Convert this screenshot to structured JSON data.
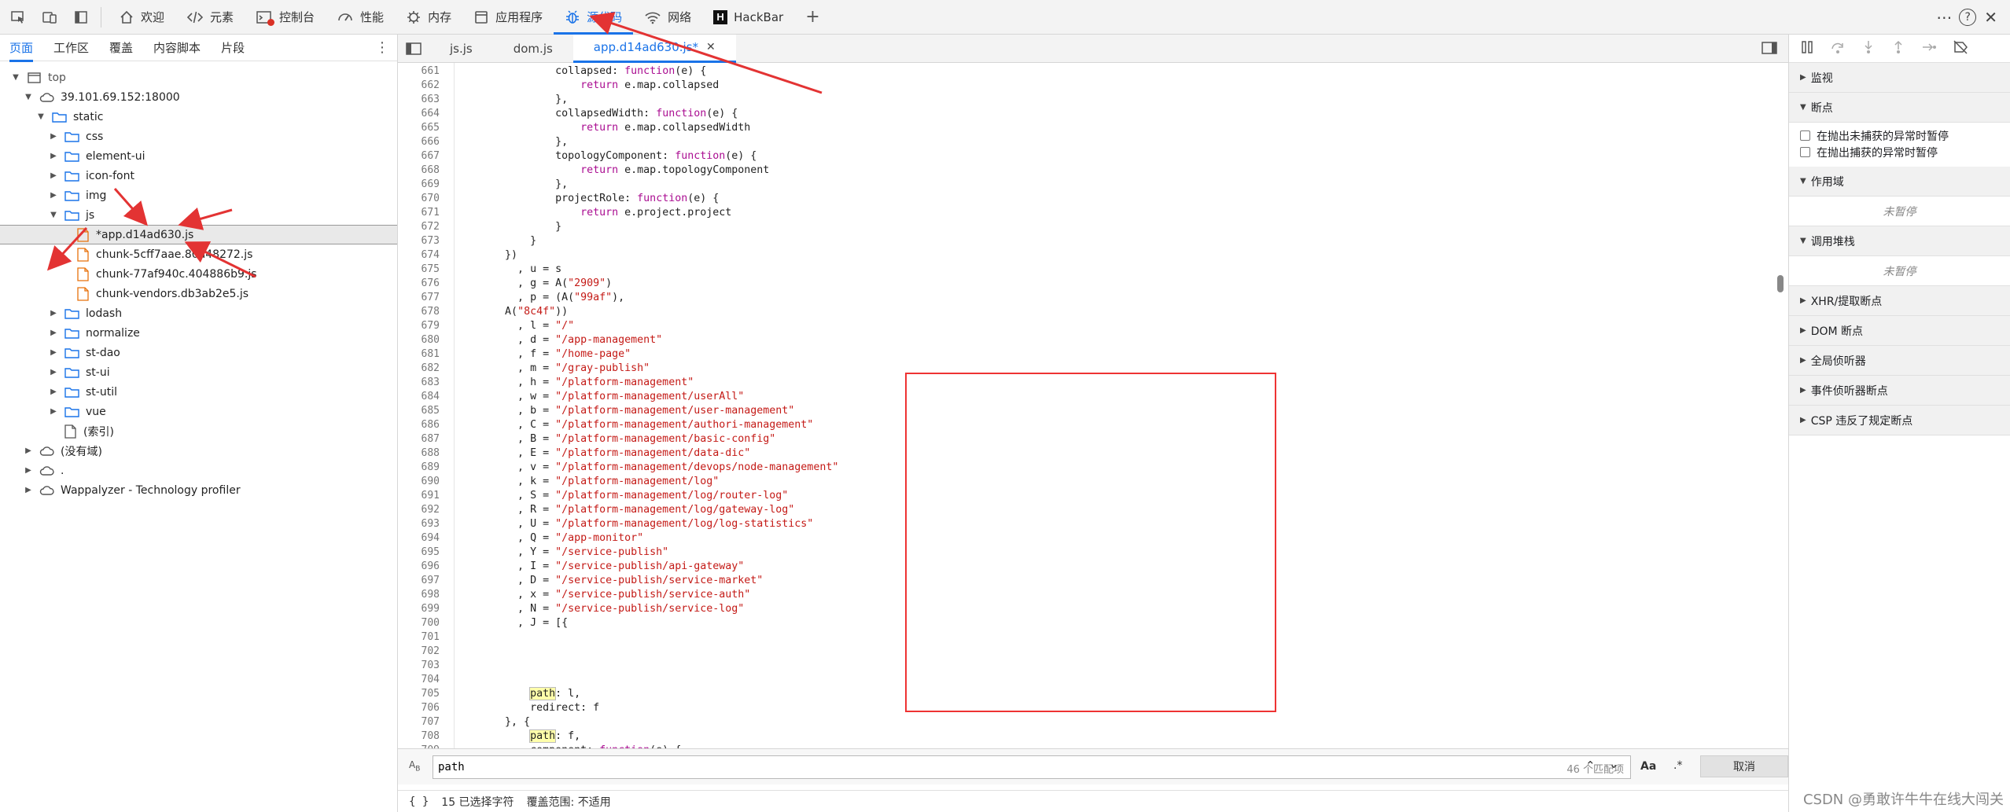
{
  "toolbar": {
    "tabs": [
      {
        "label": "欢迎",
        "icon": "home-icon"
      },
      {
        "label": "元素",
        "icon": "code-tags-icon"
      },
      {
        "label": "控制台",
        "icon": "console-icon"
      },
      {
        "label": "性能",
        "icon": "performance-icon"
      },
      {
        "label": "内存",
        "icon": "memory-icon"
      },
      {
        "label": "应用程序",
        "icon": "application-icon"
      },
      {
        "label": "源代码",
        "icon": "bug-icon",
        "active": true
      },
      {
        "label": "网络",
        "icon": "wifi-icon"
      },
      {
        "label": "HackBar",
        "icon": "hackbar-icon"
      }
    ],
    "add_tab": "+",
    "help": "?"
  },
  "navigator": {
    "tabs": [
      "页面",
      "工作区",
      "覆盖",
      "内容脚本",
      "片段"
    ],
    "tree": [
      {
        "label": "top",
        "type": "frame",
        "depth": 0,
        "expanded": true
      },
      {
        "label": "39.101.69.152:18000",
        "type": "cloud",
        "depth": 1,
        "expanded": true
      },
      {
        "label": "static",
        "type": "folder",
        "depth": 2,
        "expanded": true
      },
      {
        "label": "css",
        "type": "folder",
        "depth": 3,
        "expanded": false
      },
      {
        "label": "element-ui",
        "type": "folder",
        "depth": 3,
        "expanded": false
      },
      {
        "label": "icon-font",
        "type": "folder",
        "depth": 3,
        "expanded": false
      },
      {
        "label": "img",
        "type": "folder",
        "depth": 3,
        "expanded": false
      },
      {
        "label": "js",
        "type": "folder",
        "depth": 3,
        "expanded": true
      },
      {
        "label": "*app.d14ad630.js",
        "type": "file",
        "depth": 4,
        "selected": true
      },
      {
        "label": "chunk-5cff7aae.80a48272.js",
        "type": "file",
        "depth": 4
      },
      {
        "label": "chunk-77af940c.404886b9.js",
        "type": "file",
        "depth": 4
      },
      {
        "label": "chunk-vendors.db3ab2e5.js",
        "type": "file",
        "depth": 4
      },
      {
        "label": "lodash",
        "type": "folder",
        "depth": 3,
        "expanded": false
      },
      {
        "label": "normalize",
        "type": "folder",
        "depth": 3,
        "expanded": false
      },
      {
        "label": "st-dao",
        "type": "folder",
        "depth": 3,
        "expanded": false
      },
      {
        "label": "st-ui",
        "type": "folder",
        "depth": 3,
        "expanded": false
      },
      {
        "label": "st-util",
        "type": "folder",
        "depth": 3,
        "expanded": false
      },
      {
        "label": "vue",
        "type": "folder",
        "depth": 3,
        "expanded": false
      },
      {
        "label": "(索引)",
        "type": "doc",
        "depth": 3
      },
      {
        "label": "(没有域)",
        "type": "cloud",
        "depth": 1,
        "expanded": false
      },
      {
        "label": ".",
        "type": "cloud",
        "depth": 1,
        "expanded": false
      },
      {
        "label": "Wappalyzer - Technology profiler",
        "type": "cloud",
        "depth": 1,
        "expanded": false
      }
    ]
  },
  "editor": {
    "tabs": [
      {
        "label": "js.js"
      },
      {
        "label": "dom.js"
      },
      {
        "label": "app.d14ad630.js*",
        "active": true,
        "closable": true
      }
    ],
    "lines": [
      {
        "n": "661",
        "text": "                collapsed: function(e) {"
      },
      {
        "n": "662",
        "text": "                    return e.map.collapsed"
      },
      {
        "n": "663",
        "text": "                },"
      },
      {
        "n": "664",
        "text": "                collapsedWidth: function(e) {"
      },
      {
        "n": "665",
        "text": "                    return e.map.collapsedWidth"
      },
      {
        "n": "666",
        "text": "                },"
      },
      {
        "n": "667",
        "text": "                topologyComponent: function(e) {"
      },
      {
        "n": "668",
        "text": "                    return e.map.topologyComponent"
      },
      {
        "n": "669",
        "text": "                },"
      },
      {
        "n": "670",
        "text": "                projectRole: function(e) {"
      },
      {
        "n": "671",
        "text": "                    return e.project.project"
      },
      {
        "n": "672",
        "text": "                }"
      },
      {
        "n": "673",
        "text": "            }"
      },
      {
        "n": "674",
        "text": "        })"
      },
      {
        "n": "675",
        "text": "          , u = s"
      },
      {
        "n": "676",
        "text": "          , g = A(\"2909\")"
      },
      {
        "n": "677",
        "text": "          , p = (A(\"99af\"),"
      },
      {
        "n": "678",
        "text": "        A(\"8c4f\"))"
      },
      {
        "n": "679",
        "text": "          , l = \"/\""
      },
      {
        "n": "680",
        "text": "          , d = \"/app-management\""
      },
      {
        "n": "681",
        "text": "          , f = \"/home-page\""
      },
      {
        "n": "682",
        "text": "          , m = \"/gray-publish\""
      },
      {
        "n": "683",
        "text": "          , h = \"/platform-management\""
      },
      {
        "n": "684",
        "text": "          , w = \"/platform-management/userAll\""
      },
      {
        "n": "685",
        "text": "          , b = \"/platform-management/user-management\""
      },
      {
        "n": "686",
        "text": "          , C = \"/platform-management/authori-management\""
      },
      {
        "n": "687",
        "text": "          , B = \"/platform-management/basic-config\""
      },
      {
        "n": "688",
        "text": "          , E = \"/platform-management/data-dic\""
      },
      {
        "n": "689",
        "text": "          , v = \"/platform-management/devops/node-management\""
      },
      {
        "n": "690",
        "text": "          , k = \"/platform-management/log\""
      },
      {
        "n": "691",
        "text": "          , S = \"/platform-management/log/router-log\""
      },
      {
        "n": "692",
        "text": "          , R = \"/platform-management/log/gateway-log\""
      },
      {
        "n": "693",
        "text": "          , U = \"/platform-management/log/log-statistics\""
      },
      {
        "n": "694",
        "text": "          , Q = \"/app-monitor\""
      },
      {
        "n": "695",
        "text": "          , Y = \"/service-publish\""
      },
      {
        "n": "696",
        "text": "          , I = \"/service-publish/api-gateway\""
      },
      {
        "n": "697",
        "text": "          , D = \"/service-publish/service-market\""
      },
      {
        "n": "698",
        "text": "          , x = \"/service-publish/service-auth\""
      },
      {
        "n": "699",
        "text": "          , N = \"/service-publish/service-log\""
      },
      {
        "n": "700",
        "text": "          , J = [{"
      },
      {
        "n": "701",
        "text": ""
      },
      {
        "n": "702",
        "text": ""
      },
      {
        "n": "703",
        "text": ""
      },
      {
        "n": "704",
        "text": ""
      },
      {
        "n": "705",
        "text": "            path: l,"
      },
      {
        "n": "706",
        "text": "            redirect: f"
      },
      {
        "n": "707",
        "text": "        }, {"
      },
      {
        "n": "708",
        "text": "            path: f,"
      },
      {
        "n": "709",
        "text": "            component: function(e) {"
      }
    ]
  },
  "search": {
    "query": "path",
    "match_count": "46 个匹配项",
    "match_case": "Aa",
    "regex": ".*",
    "cancel": "取消"
  },
  "status": {
    "braces": "{ }",
    "selection": "15 已选择字符",
    "coverage": "覆盖范围: 不适用"
  },
  "debugger": {
    "sections": [
      {
        "label": "监视",
        "expanded": false
      },
      {
        "label": "断点",
        "expanded": true
      },
      {
        "label": "作用域",
        "expanded": true
      },
      {
        "label": "调用堆栈",
        "expanded": true
      },
      {
        "label": "XHR/提取断点",
        "expanded": false
      },
      {
        "label": "DOM 断点",
        "expanded": false
      },
      {
        "label": "全局侦听器",
        "expanded": false
      },
      {
        "label": "事件侦听器断点",
        "expanded": false
      },
      {
        "label": "CSP 违反了规定断点",
        "expanded": false
      }
    ],
    "breakpoint_options": [
      "在抛出未捕获的异常时暂停",
      "在抛出捕获的异常时暂停"
    ],
    "not_paused": "未暂停"
  },
  "watermark": "CSDN @勇敢许牛牛在线大闯关",
  "colors": {
    "accent": "#1a73e8",
    "annotation_red": "#e33333",
    "string": "#c41a16",
    "keyword": "#aa0d91"
  }
}
